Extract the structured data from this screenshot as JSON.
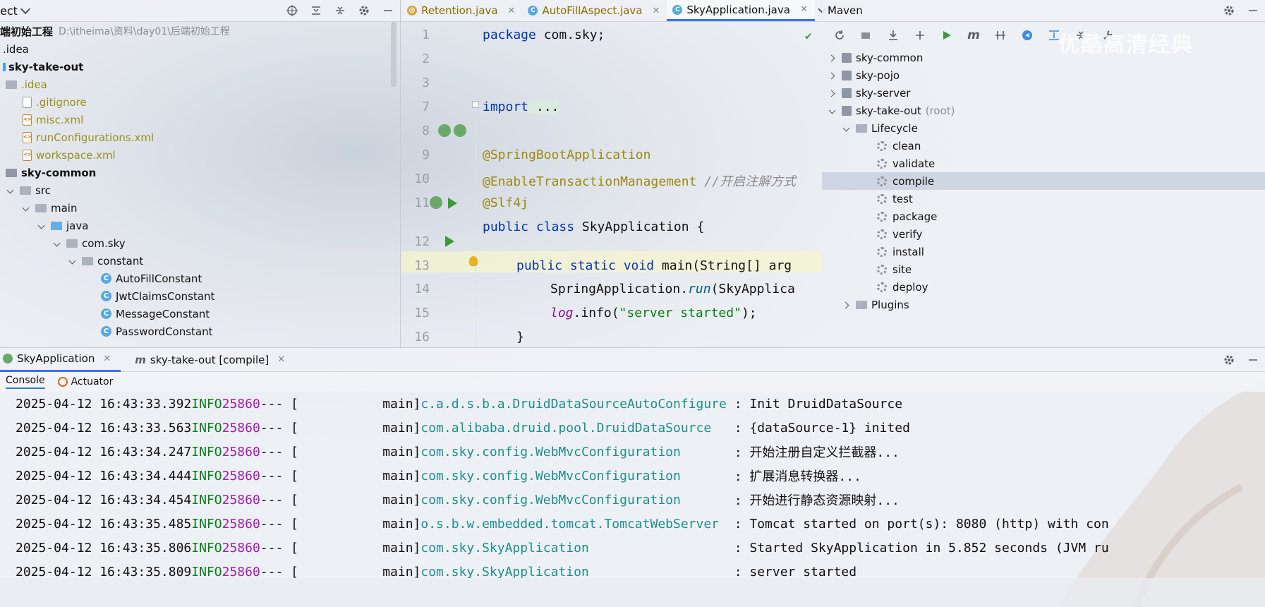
{
  "project": {
    "header_title": "ect",
    "root_label": "端初始工程",
    "root_path": "D:\\itheima\\资料\\day01\\后端初始工程",
    "items": [
      ".idea",
      "sky-take-out",
      ".idea",
      ".gitignore",
      "misc.xml",
      "runConfigurations.xml",
      "workspace.xml",
      "sky-common",
      "src",
      "main",
      "java",
      "com.sky",
      "constant",
      "AutoFillConstant",
      "JwtClaimsConstant",
      "MessageConstant",
      "PasswordConstant"
    ]
  },
  "editor": {
    "tabs": [
      {
        "label": "Retention.java"
      },
      {
        "label": "AutoFillAspect.java"
      },
      {
        "label": "SkyApplication.java"
      }
    ],
    "line_numbers": [
      "1",
      "2",
      "3",
      "7",
      "8",
      "9",
      "10",
      "11",
      "12",
      "13",
      "14",
      "15",
      "16"
    ],
    "code": {
      "l1_kw": "package",
      "l1_rest": " com.sky;",
      "l3_kw": "import",
      "l3_rest": " ...",
      "l8": "@SpringBootApplication",
      "l9_an": "@EnableTransactionManagement",
      "l9_cm": " //开启注解方式",
      "l10": "@Slf4j",
      "l11_kw": "public class",
      "l11_rest": " SkyApplication {",
      "l12_kw": "public static void",
      "l12_rest": " main(String[] arg",
      "l13_a": "SpringApplication.",
      "l13_b": "run",
      "l13_c": "(SkyApplica",
      "l14_a": "log",
      "l14_b": ".info(",
      "l14_c": "\"server started\"",
      "l14_d": ");",
      "l15": "}",
      "l16": "}"
    }
  },
  "maven": {
    "title": "Maven",
    "modules": [
      "sky-common",
      "sky-pojo",
      "sky-server",
      "sky-take-out"
    ],
    "root_suffix": "(root)",
    "lifecycle_label": "Lifecycle",
    "goals": [
      "clean",
      "validate",
      "compile",
      "test",
      "package",
      "verify",
      "install",
      "site",
      "deploy"
    ],
    "plugins_label": "Plugins"
  },
  "bottom": {
    "tabs": [
      {
        "label": "SkyApplication"
      },
      {
        "label": "sky-take-out [compile]"
      }
    ],
    "subtabs": [
      "Console",
      "Actuator"
    ],
    "logs": [
      {
        "ts": "2025-04-12 16:43:33.392",
        "level": "INFO",
        "pid": "25860",
        "sep": "--- [",
        "thread": "           main]",
        "logger": "c.a.d.s.b.a.DruidDataSourceAutoConfigure",
        "msg": " : Init DruidDataSource"
      },
      {
        "ts": "2025-04-12 16:43:33.563",
        "level": "INFO",
        "pid": "25860",
        "sep": "--- [",
        "thread": "           main]",
        "logger": "com.alibaba.druid.pool.DruidDataSource  ",
        "msg": " : {dataSource-1} inited"
      },
      {
        "ts": "2025-04-12 16:43:34.247",
        "level": "INFO",
        "pid": "25860",
        "sep": "--- [",
        "thread": "           main]",
        "logger": "com.sky.config.WebMvcConfiguration      ",
        "msg": " : 开始注册自定义拦截器..."
      },
      {
        "ts": "2025-04-12 16:43:34.444",
        "level": "INFO",
        "pid": "25860",
        "sep": "--- [",
        "thread": "           main]",
        "logger": "com.sky.config.WebMvcConfiguration      ",
        "msg": " : 扩展消息转换器..."
      },
      {
        "ts": "2025-04-12 16:43:34.454",
        "level": "INFO",
        "pid": "25860",
        "sep": "--- [",
        "thread": "           main]",
        "logger": "com.sky.config.WebMvcConfiguration      ",
        "msg": " : 开始进行静态资源映射..."
      },
      {
        "ts": "2025-04-12 16:43:35.485",
        "level": "INFO",
        "pid": "25860",
        "sep": "--- [",
        "thread": "           main]",
        "logger": "o.s.b.w.embedded.tomcat.TomcatWebServer ",
        "msg": " : Tomcat started on port(s): 8080 (http) with con"
      },
      {
        "ts": "2025-04-12 16:43:35.806",
        "level": "INFO",
        "pid": "25860",
        "sep": "--- [",
        "thread": "           main]",
        "logger": "com.sky.SkyApplication                  ",
        "msg": " : Started SkyApplication in 5.852 seconds (JVM ru"
      },
      {
        "ts": "2025-04-12 16:43:35.809",
        "level": "INFO",
        "pid": "25860",
        "sep": "--- [",
        "thread": "           main]",
        "logger": "com.sky.SkyApplication                  ",
        "msg": " : server started"
      }
    ]
  },
  "watermark": "优酷高清经典",
  "colors": {
    "accent": "#3574f0",
    "keyword": "#0033b3",
    "annotation": "#9e880d",
    "string": "#067d17",
    "pid": "#a21caf",
    "logger": "#1d8f8f"
  }
}
